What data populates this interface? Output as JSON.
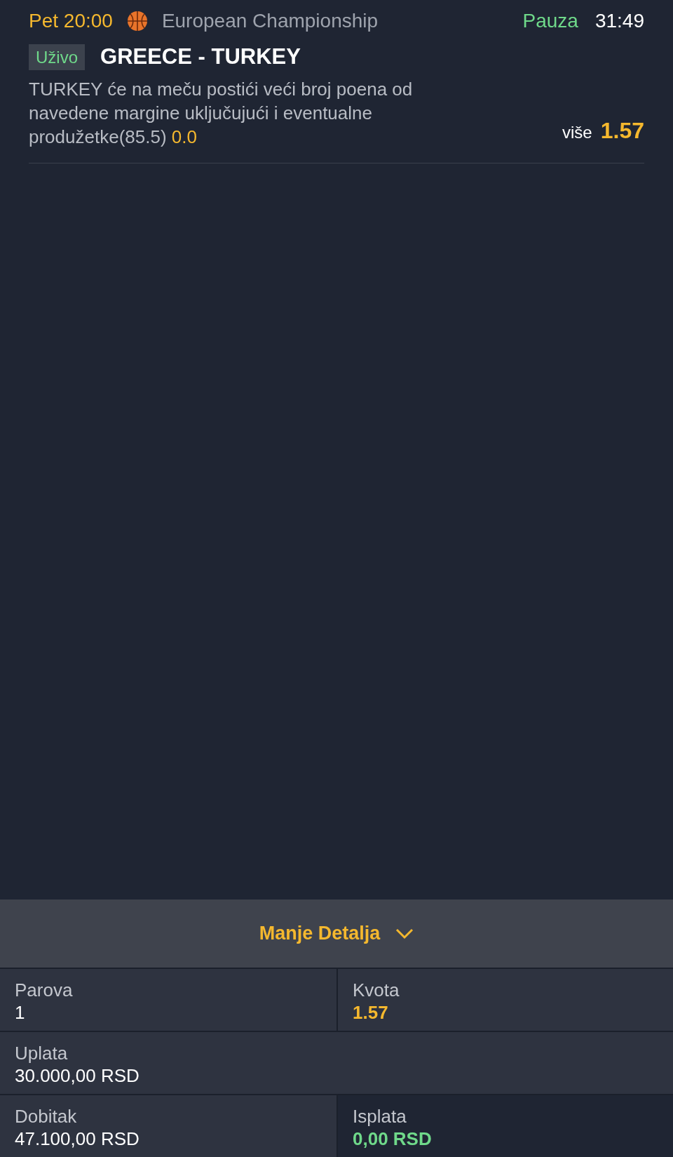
{
  "event": {
    "day_time": "Pet 20:00",
    "competition": "European Championship",
    "status": "Pauza",
    "clock": "31:49",
    "live_badge": "Uživo",
    "title": "GREECE - TURKEY",
    "description": "TURKEY će na meču postići veći broj poena od navedene margine uključujući i eventualne produžetke(85.5)",
    "handicap": "0.0",
    "pick": "više",
    "odds": "1.57"
  },
  "details_toggle": {
    "label": "Manje Detalja",
    "expanded": true
  },
  "summary": {
    "rows": [
      [
        {
          "label": "Parova",
          "value": "1",
          "kind": "plain"
        },
        {
          "label": "Kvota",
          "value": "1.57",
          "kind": "odds"
        }
      ],
      [
        {
          "label": "Uplata",
          "value": "30.000,00 RSD",
          "kind": "plain"
        }
      ],
      [
        {
          "label": "Dobitak",
          "value": "47.100,00 RSD",
          "kind": "plain"
        },
        {
          "label": "Isplata",
          "value": "0,00 RSD",
          "kind": "payout"
        }
      ]
    ]
  }
}
